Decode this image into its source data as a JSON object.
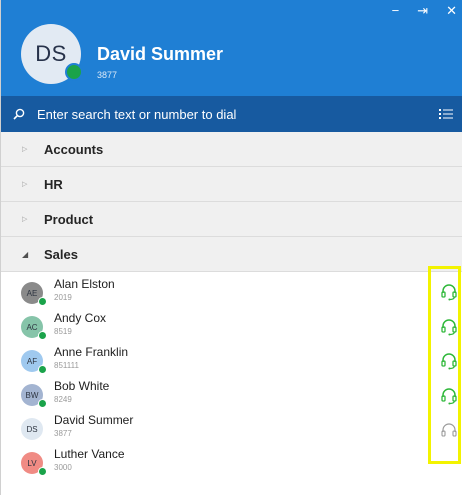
{
  "window": {
    "minimize": "−",
    "pin": "⇥",
    "close": "✕"
  },
  "user": {
    "initials": "DS",
    "name": "David Summer",
    "extension": "3877",
    "status_color": "#1aa34a"
  },
  "search": {
    "placeholder": "Enter search text or number to dial"
  },
  "groups": [
    {
      "label": "Accounts",
      "expanded": false
    },
    {
      "label": "HR",
      "expanded": false
    },
    {
      "label": "Product",
      "expanded": false
    },
    {
      "label": "Sales",
      "expanded": true
    }
  ],
  "contacts": [
    {
      "initials": "AE",
      "name": "Alan Elston",
      "ext": "2019",
      "avatar_color": "#8a8a8a",
      "headset": "active"
    },
    {
      "initials": "AC",
      "name": "Andy Cox",
      "ext": "8519",
      "avatar_color": "#86c4a9",
      "headset": "active"
    },
    {
      "initials": "AF",
      "name": "Anne Franklin",
      "ext": "851111",
      "avatar_color": "#9fc9ef",
      "headset": "active"
    },
    {
      "initials": "BW",
      "name": "Bob White",
      "ext": "8249",
      "avatar_color": "#a3b4d1",
      "headset": "active"
    },
    {
      "initials": "DS",
      "name": "David Summer",
      "ext": "3877",
      "avatar_color": "#dfe8f1",
      "headset": "inactive"
    },
    {
      "initials": "LV",
      "name": "Luther Vance",
      "ext": "3000",
      "avatar_color": "#f08b84",
      "headset": "none"
    }
  ],
  "colors": {
    "header": "#1f7fd4",
    "search_bar": "#175aa0",
    "headset_active": "#2fb83a",
    "headset_inactive": "#9a9a9a",
    "highlight": "#f3f300"
  }
}
